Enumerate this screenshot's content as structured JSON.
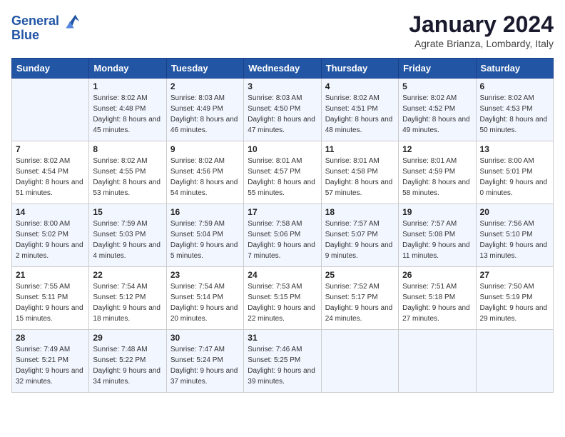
{
  "header": {
    "logo_line1": "General",
    "logo_line2": "Blue",
    "title": "January 2024",
    "subtitle": "Agrate Brianza, Lombardy, Italy"
  },
  "columns": [
    "Sunday",
    "Monday",
    "Tuesday",
    "Wednesday",
    "Thursday",
    "Friday",
    "Saturday"
  ],
  "weeks": [
    [
      {
        "day": "",
        "sunrise": "",
        "sunset": "",
        "daylight": ""
      },
      {
        "day": "1",
        "sunrise": "Sunrise: 8:02 AM",
        "sunset": "Sunset: 4:48 PM",
        "daylight": "Daylight: 8 hours and 45 minutes."
      },
      {
        "day": "2",
        "sunrise": "Sunrise: 8:03 AM",
        "sunset": "Sunset: 4:49 PM",
        "daylight": "Daylight: 8 hours and 46 minutes."
      },
      {
        "day": "3",
        "sunrise": "Sunrise: 8:03 AM",
        "sunset": "Sunset: 4:50 PM",
        "daylight": "Daylight: 8 hours and 47 minutes."
      },
      {
        "day": "4",
        "sunrise": "Sunrise: 8:02 AM",
        "sunset": "Sunset: 4:51 PM",
        "daylight": "Daylight: 8 hours and 48 minutes."
      },
      {
        "day": "5",
        "sunrise": "Sunrise: 8:02 AM",
        "sunset": "Sunset: 4:52 PM",
        "daylight": "Daylight: 8 hours and 49 minutes."
      },
      {
        "day": "6",
        "sunrise": "Sunrise: 8:02 AM",
        "sunset": "Sunset: 4:53 PM",
        "daylight": "Daylight: 8 hours and 50 minutes."
      }
    ],
    [
      {
        "day": "7",
        "sunrise": "Sunrise: 8:02 AM",
        "sunset": "Sunset: 4:54 PM",
        "daylight": "Daylight: 8 hours and 51 minutes."
      },
      {
        "day": "8",
        "sunrise": "Sunrise: 8:02 AM",
        "sunset": "Sunset: 4:55 PM",
        "daylight": "Daylight: 8 hours and 53 minutes."
      },
      {
        "day": "9",
        "sunrise": "Sunrise: 8:02 AM",
        "sunset": "Sunset: 4:56 PM",
        "daylight": "Daylight: 8 hours and 54 minutes."
      },
      {
        "day": "10",
        "sunrise": "Sunrise: 8:01 AM",
        "sunset": "Sunset: 4:57 PM",
        "daylight": "Daylight: 8 hours and 55 minutes."
      },
      {
        "day": "11",
        "sunrise": "Sunrise: 8:01 AM",
        "sunset": "Sunset: 4:58 PM",
        "daylight": "Daylight: 8 hours and 57 minutes."
      },
      {
        "day": "12",
        "sunrise": "Sunrise: 8:01 AM",
        "sunset": "Sunset: 4:59 PM",
        "daylight": "Daylight: 8 hours and 58 minutes."
      },
      {
        "day": "13",
        "sunrise": "Sunrise: 8:00 AM",
        "sunset": "Sunset: 5:01 PM",
        "daylight": "Daylight: 9 hours and 0 minutes."
      }
    ],
    [
      {
        "day": "14",
        "sunrise": "Sunrise: 8:00 AM",
        "sunset": "Sunset: 5:02 PM",
        "daylight": "Daylight: 9 hours and 2 minutes."
      },
      {
        "day": "15",
        "sunrise": "Sunrise: 7:59 AM",
        "sunset": "Sunset: 5:03 PM",
        "daylight": "Daylight: 9 hours and 4 minutes."
      },
      {
        "day": "16",
        "sunrise": "Sunrise: 7:59 AM",
        "sunset": "Sunset: 5:04 PM",
        "daylight": "Daylight: 9 hours and 5 minutes."
      },
      {
        "day": "17",
        "sunrise": "Sunrise: 7:58 AM",
        "sunset": "Sunset: 5:06 PM",
        "daylight": "Daylight: 9 hours and 7 minutes."
      },
      {
        "day": "18",
        "sunrise": "Sunrise: 7:57 AM",
        "sunset": "Sunset: 5:07 PM",
        "daylight": "Daylight: 9 hours and 9 minutes."
      },
      {
        "day": "19",
        "sunrise": "Sunrise: 7:57 AM",
        "sunset": "Sunset: 5:08 PM",
        "daylight": "Daylight: 9 hours and 11 minutes."
      },
      {
        "day": "20",
        "sunrise": "Sunrise: 7:56 AM",
        "sunset": "Sunset: 5:10 PM",
        "daylight": "Daylight: 9 hours and 13 minutes."
      }
    ],
    [
      {
        "day": "21",
        "sunrise": "Sunrise: 7:55 AM",
        "sunset": "Sunset: 5:11 PM",
        "daylight": "Daylight: 9 hours and 15 minutes."
      },
      {
        "day": "22",
        "sunrise": "Sunrise: 7:54 AM",
        "sunset": "Sunset: 5:12 PM",
        "daylight": "Daylight: 9 hours and 18 minutes."
      },
      {
        "day": "23",
        "sunrise": "Sunrise: 7:54 AM",
        "sunset": "Sunset: 5:14 PM",
        "daylight": "Daylight: 9 hours and 20 minutes."
      },
      {
        "day": "24",
        "sunrise": "Sunrise: 7:53 AM",
        "sunset": "Sunset: 5:15 PM",
        "daylight": "Daylight: 9 hours and 22 minutes."
      },
      {
        "day": "25",
        "sunrise": "Sunrise: 7:52 AM",
        "sunset": "Sunset: 5:17 PM",
        "daylight": "Daylight: 9 hours and 24 minutes."
      },
      {
        "day": "26",
        "sunrise": "Sunrise: 7:51 AM",
        "sunset": "Sunset: 5:18 PM",
        "daylight": "Daylight: 9 hours and 27 minutes."
      },
      {
        "day": "27",
        "sunrise": "Sunrise: 7:50 AM",
        "sunset": "Sunset: 5:19 PM",
        "daylight": "Daylight: 9 hours and 29 minutes."
      }
    ],
    [
      {
        "day": "28",
        "sunrise": "Sunrise: 7:49 AM",
        "sunset": "Sunset: 5:21 PM",
        "daylight": "Daylight: 9 hours and 32 minutes."
      },
      {
        "day": "29",
        "sunrise": "Sunrise: 7:48 AM",
        "sunset": "Sunset: 5:22 PM",
        "daylight": "Daylight: 9 hours and 34 minutes."
      },
      {
        "day": "30",
        "sunrise": "Sunrise: 7:47 AM",
        "sunset": "Sunset: 5:24 PM",
        "daylight": "Daylight: 9 hours and 37 minutes."
      },
      {
        "day": "31",
        "sunrise": "Sunrise: 7:46 AM",
        "sunset": "Sunset: 5:25 PM",
        "daylight": "Daylight: 9 hours and 39 minutes."
      },
      {
        "day": "",
        "sunrise": "",
        "sunset": "",
        "daylight": ""
      },
      {
        "day": "",
        "sunrise": "",
        "sunset": "",
        "daylight": ""
      },
      {
        "day": "",
        "sunrise": "",
        "sunset": "",
        "daylight": ""
      }
    ]
  ]
}
